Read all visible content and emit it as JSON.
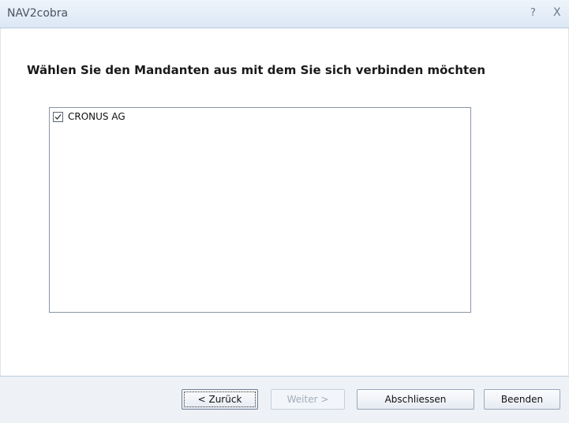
{
  "window": {
    "title": "NAV2cobra",
    "help_glyph": "?",
    "close_glyph": "X"
  },
  "main": {
    "heading": "Wählen Sie den Mandanten aus mit dem Sie sich verbinden möchten",
    "company_list": [
      {
        "label": "CRONUS AG",
        "checked": true
      }
    ]
  },
  "footer": {
    "back_label": "< Zurück",
    "next_label": "Weiter >",
    "finish_label": "Abschliessen",
    "cancel_label": "Beenden"
  }
}
